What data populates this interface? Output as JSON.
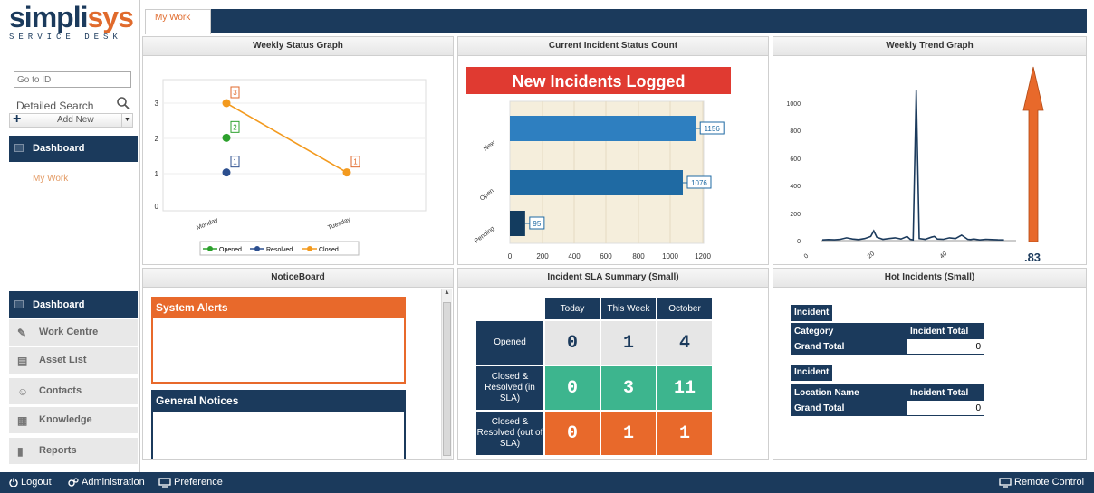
{
  "logo": {
    "part1": "simpli",
    "part2": "sys",
    "sub": "SERVICE DESK"
  },
  "sidebar": {
    "goto_placeholder": "Go to ID",
    "detailed_search": "Detailed Search",
    "add_new": "Add New",
    "top_nav": {
      "label": "Dashboard"
    },
    "sub_link": "My Work",
    "items": [
      {
        "label": "Dashboard",
        "icon": "dashboard-icon",
        "active": true
      },
      {
        "label": "Work Centre",
        "icon": "wrench-icon"
      },
      {
        "label": "Asset List",
        "icon": "asset-icon"
      },
      {
        "label": "Contacts",
        "icon": "contacts-icon"
      },
      {
        "label": "Knowledge",
        "icon": "book-icon"
      },
      {
        "label": "Reports",
        "icon": "reports-icon"
      }
    ]
  },
  "tabs": {
    "active": "My Work"
  },
  "panels": {
    "weekly": "Weekly Status Graph",
    "current": "Current Incident Status Count",
    "trend": "Weekly Trend Graph",
    "notice": "NoticeBoard",
    "sla": "Incident SLA Summary (Small)",
    "hot": "Hot Incidents (Small)"
  },
  "colors": {
    "navy": "#1b3a5c",
    "orange": "#e8692b",
    "teal": "#3db58e",
    "green": "#2ca02c",
    "blue": "#2c4f8f",
    "amber": "#f39a1e"
  },
  "chart_data": [
    {
      "type": "line",
      "categories": [
        "Monday",
        "Tuesday"
      ],
      "series": [
        {
          "name": "Opened",
          "values": [
            2,
            null
          ]
        },
        {
          "name": "Resolved",
          "values": [
            1,
            null
          ]
        },
        {
          "name": "Closed",
          "values": [
            3,
            1
          ]
        }
      ],
      "ylim": [
        0,
        3
      ],
      "yticks": [
        "0",
        "1",
        "2",
        "3"
      ],
      "legend": "bottom",
      "data_labels": [
        "3",
        "2",
        "1",
        "1"
      ]
    },
    {
      "type": "bar",
      "orientation": "horizontal",
      "banner": "New Incidents Logged",
      "categories": [
        "New",
        "Open",
        "Pending"
      ],
      "values": [
        1156,
        1076,
        95
      ],
      "xlim": [
        0,
        1200
      ],
      "xticks": [
        "0",
        "200",
        "400",
        "600",
        "800",
        "1000",
        "1200"
      ]
    },
    {
      "type": "line",
      "x": [
        0,
        2,
        4,
        6,
        8,
        10,
        12,
        14,
        16,
        17,
        18,
        20,
        22,
        24,
        26,
        28,
        29,
        30,
        31,
        32,
        34,
        36,
        37,
        38,
        40,
        42,
        44,
        46,
        48,
        49,
        50,
        52,
        54,
        56,
        58,
        60
      ],
      "values": [
        5,
        8,
        6,
        10,
        20,
        12,
        8,
        15,
        30,
        70,
        25,
        10,
        15,
        20,
        12,
        30,
        10,
        5,
        1080,
        15,
        10,
        25,
        30,
        12,
        10,
        20,
        15,
        40,
        10,
        8,
        12,
        5,
        10,
        8,
        6,
        5
      ],
      "xlim": [
        0,
        64
      ],
      "ylim": [
        0,
        1080
      ],
      "xticks": [
        "0",
        "20",
        "40"
      ],
      "yticks": [
        "0",
        "200",
        "400",
        "600",
        "800",
        "1000"
      ],
      "value_label": ".83"
    }
  ],
  "notice": {
    "alerts_title": "System Alerts",
    "general_title": "General Notices"
  },
  "sla": {
    "columns": [
      "Today",
      "This Week",
      "October"
    ],
    "rows": [
      {
        "label": "Opened",
        "values": [
          "0",
          "1",
          "4"
        ]
      },
      {
        "label": "Closed & Resolved (in SLA)",
        "values": [
          "0",
          "3",
          "11"
        ]
      },
      {
        "label": "Closed & Resolved (out of SLA)",
        "values": [
          "0",
          "1",
          "1"
        ]
      }
    ]
  },
  "hot": {
    "table1": {
      "tag": "Incident",
      "col1": "Category",
      "col2": "Incident Total",
      "total_label": "Grand Total",
      "total_value": "0"
    },
    "table2": {
      "tag": "Incident",
      "col1": "Location Name",
      "col2": "Incident Total",
      "total_label": "Grand Total",
      "total_value": "0"
    }
  },
  "bottom": {
    "logout": "Logout",
    "admin": "Administration",
    "pref": "Preference",
    "remote": "Remote Control"
  }
}
